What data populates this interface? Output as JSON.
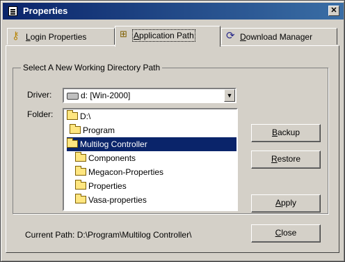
{
  "window": {
    "title": "Properties",
    "close_glyph": "✕"
  },
  "tabs": [
    {
      "label": "Login Properties",
      "icon": "key-icon",
      "active": false
    },
    {
      "label": "Application Path",
      "icon": "tree-icon",
      "active": true
    },
    {
      "label": "Download Manager",
      "icon": "download-icon",
      "active": false
    }
  ],
  "group": {
    "title": "Select A New Working Directory Path",
    "driver_label": "Driver:",
    "driver_value": "d: [Win-2000]",
    "folder_label": "Folder:"
  },
  "folders": [
    {
      "name": "D:\\",
      "depth": 0,
      "open": true,
      "selected": false
    },
    {
      "name": "Program",
      "depth": 1,
      "open": true,
      "selected": false
    },
    {
      "name": "Multilog Controller",
      "depth": 2,
      "open": true,
      "selected": true
    },
    {
      "name": "Components",
      "depth": 3,
      "open": false,
      "selected": false
    },
    {
      "name": "Megacon-Properties",
      "depth": 3,
      "open": false,
      "selected": false
    },
    {
      "name": "Properties",
      "depth": 3,
      "open": false,
      "selected": false
    },
    {
      "name": "Vasa-properties",
      "depth": 3,
      "open": false,
      "selected": false
    }
  ],
  "buttons": {
    "backup": "Backup",
    "restore": "Restore",
    "apply": "Apply",
    "close": "Close"
  },
  "current_path": "Current Path: D:\\Program\\Multilog Controller\\",
  "colors": {
    "titlebar": "#0a246a",
    "selection": "#0a246a",
    "face": "#d4d0c8"
  }
}
